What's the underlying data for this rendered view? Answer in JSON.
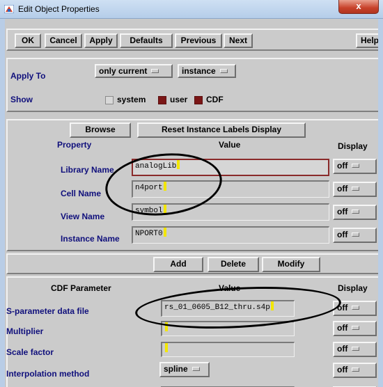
{
  "window": {
    "title": "Edit Object Properties",
    "close_glyph": "x"
  },
  "toolbar": {
    "ok": "OK",
    "cancel": "Cancel",
    "apply": "Apply",
    "defaults": "Defaults",
    "previous": "Previous",
    "next": "Next",
    "help": "Help"
  },
  "apply_to": {
    "label": "Apply To",
    "scope": "only current",
    "object": "instance"
  },
  "show": {
    "label": "Show",
    "system": "system",
    "user": "user",
    "cdf": "CDF",
    "system_checked": false,
    "user_checked": true,
    "cdf_checked": true
  },
  "properties": {
    "browse": "Browse",
    "reset": "Reset Instance Labels Display",
    "header_property": "Property",
    "header_value": "Value",
    "header_display": "Display",
    "rows": [
      {
        "name": "Library Name",
        "value": "analogLib",
        "display": "off"
      },
      {
        "name": "Cell Name",
        "value": "n4port",
        "display": "off"
      },
      {
        "name": "View Name",
        "value": "symbol",
        "display": "off"
      },
      {
        "name": "Instance Name",
        "value": "NPORT0",
        "display": "off"
      }
    ]
  },
  "actions": {
    "add": "Add",
    "delete": "Delete",
    "modify": "Modify"
  },
  "cdf": {
    "header_param": "CDF Parameter",
    "header_value": "Value",
    "header_display": "Display",
    "rows": [
      {
        "name": "S-parameter data file",
        "value": "rs_01_0605_B12_thru.s4p",
        "display": "off"
      },
      {
        "name": "Multiplier",
        "value": "",
        "display": "off"
      },
      {
        "name": "Scale factor",
        "value": "",
        "display": "off"
      },
      {
        "name": "Interpolation method",
        "value": "spline",
        "display": "off"
      }
    ]
  },
  "colors": {
    "panel_bg": "#cbcbcb",
    "label_blue": "#10107c",
    "checkbox_on": "#7b1616",
    "cursor": "#f2e600"
  }
}
